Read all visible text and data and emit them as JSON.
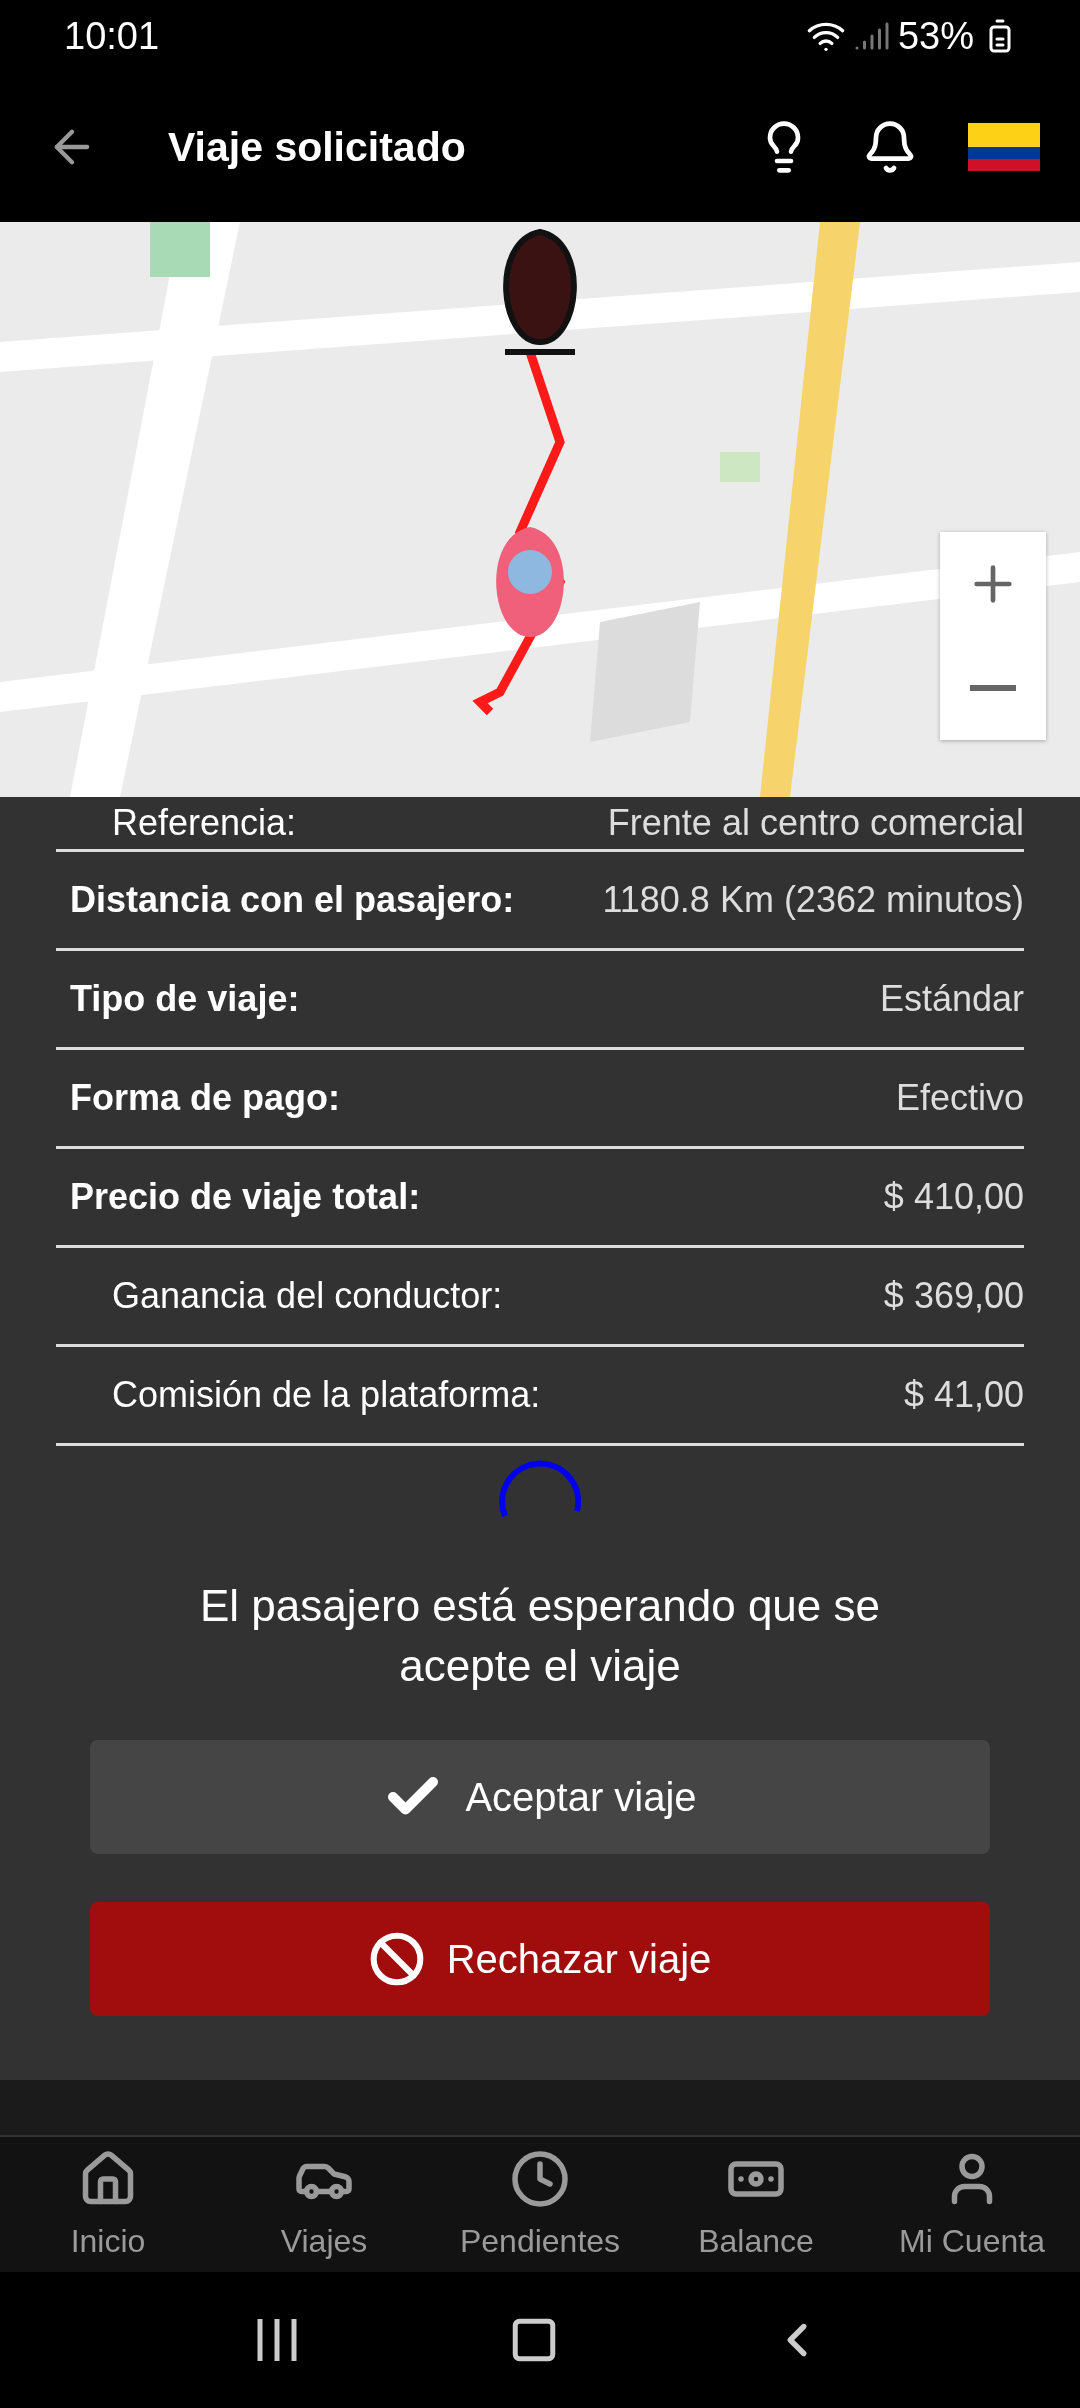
{
  "status_bar": {
    "time": "10:01",
    "battery": "53%"
  },
  "header": {
    "title": "Viaje solicitado"
  },
  "details": [
    {
      "label": "Referencia:",
      "value": "Frente al centro comercial",
      "kind": "sub"
    },
    {
      "label": "Distancia con el pasajero:",
      "value": "1180.8 Km (2362 minutos)",
      "kind": "main"
    },
    {
      "label": "Tipo de viaje:",
      "value": "Estándar",
      "kind": "main"
    },
    {
      "label": "Forma de pago:",
      "value": "Efectivo",
      "kind": "main"
    },
    {
      "label": "Precio de viaje total:",
      "value": "$ 410,00",
      "kind": "main"
    },
    {
      "label": "Ganancia del conductor:",
      "value": "$ 369,00",
      "kind": "sub"
    },
    {
      "label": "Comisión de la plataforma:",
      "value": "$ 41,00",
      "kind": "sub"
    }
  ],
  "message": "El pasajero está esperando que se acepte el viaje",
  "buttons": [
    {
      "label": "Aceptar viaje",
      "kind": "accept"
    },
    {
      "label": "Rechazar viaje",
      "kind": "reject"
    }
  ],
  "bottom_nav": [
    {
      "label": "Inicio",
      "kind": "home"
    },
    {
      "label": "Viajes",
      "kind": "car"
    },
    {
      "label": "Pendientes",
      "kind": "clock"
    },
    {
      "label": "Balance",
      "kind": "money"
    },
    {
      "label": "Mi Cuenta",
      "kind": "user"
    }
  ]
}
